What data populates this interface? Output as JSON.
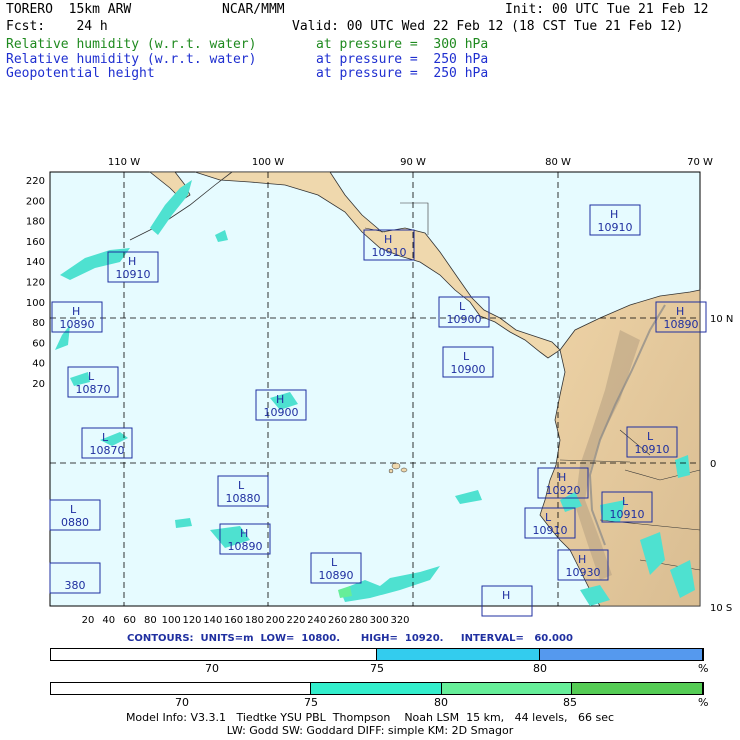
{
  "header": {
    "model": "TORERO  15km ARW",
    "center": "NCAR/MMM",
    "init": "Init: 00 UTC Tue 21 Feb 12",
    "fcst": "Fcst:    24 h",
    "valid": "Valid: 00 UTC Wed 22 Feb 12 (18 CST Tue 21 Feb 12)",
    "fields": [
      {
        "name": "Relative humidity (w.r.t. water)",
        "level": "at pressure =  300 hPa",
        "color": "#1f8a1f"
      },
      {
        "name": "Relative humidity (w.r.t. water)",
        "level": "at pressure =  250 hPa",
        "color": "#1f2fd0"
      },
      {
        "name": "Geopotential height",
        "level": "at pressure =  250 hPa",
        "color": "#1f2fd0"
      }
    ]
  },
  "map": {
    "top_ticks": [
      "110 W",
      "100 W",
      "90 W",
      "80 W",
      "70 W"
    ],
    "right_ticks": [
      "10 N",
      "0",
      "10 S"
    ],
    "left_ticks": [
      "220",
      "200",
      "180",
      "160",
      "140",
      "120",
      "100",
      "80",
      "60",
      "40",
      "20"
    ],
    "bottom_ticks": [
      "20",
      "40",
      "60",
      "80",
      "100",
      "120",
      "140",
      "160",
      "180",
      "200",
      "220",
      "240",
      "260",
      "280",
      "300",
      "320"
    ],
    "centers": [
      {
        "type": "H",
        "value": "10910"
      },
      {
        "type": "H",
        "value": "10910"
      },
      {
        "type": "H",
        "value": "10910"
      },
      {
        "type": "H",
        "value": "10890"
      },
      {
        "type": "L",
        "value": "10900"
      },
      {
        "type": "H",
        "value": "10890"
      },
      {
        "type": "L",
        "value": "10900"
      },
      {
        "type": "L",
        "value": "10870"
      },
      {
        "type": "H",
        "value": "10900"
      },
      {
        "type": "L",
        "value": "10870"
      },
      {
        "type": "L",
        "value": "10910"
      },
      {
        "type": "H",
        "value": "10920"
      },
      {
        "type": "L",
        "value": "10880"
      },
      {
        "type": "L",
        "value": "10910"
      },
      {
        "type": "L",
        "value": "10910"
      },
      {
        "type": "L",
        "value": "0880"
      },
      {
        "type": "H",
        "value": "10890"
      },
      {
        "type": "H",
        "value": "10930"
      },
      {
        "type": "L",
        "value": "10890"
      },
      {
        "type": "",
        "value": "380"
      },
      {
        "type": "H",
        "value": ""
      }
    ]
  },
  "contours": {
    "text": "CONTOURS:  UNITS=m  LOW=  10800.      HIGH=  10920.     INTERVAL=   60.000"
  },
  "colorbars": [
    {
      "ticks": [
        "70",
        "75",
        "80"
      ],
      "unit": "%",
      "colors": [
        "#ffffff",
        "#33ccee",
        "#5599ee"
      ]
    },
    {
      "ticks": [
        "70",
        "75",
        "80",
        "85"
      ],
      "unit": "%",
      "colors": [
        "#ffffff",
        "#33eecc",
        "#66ee99",
        "#55cc55"
      ]
    }
  ],
  "footer": {
    "line1": "Model Info: V3.3.1   Tiedtke YSU PBL  Thompson    Noah LSM  15 km,   44 levels,   66 sec",
    "line2": "LW: Godd SW: Goddard DIFF: simple KM: 2D Smagor"
  }
}
